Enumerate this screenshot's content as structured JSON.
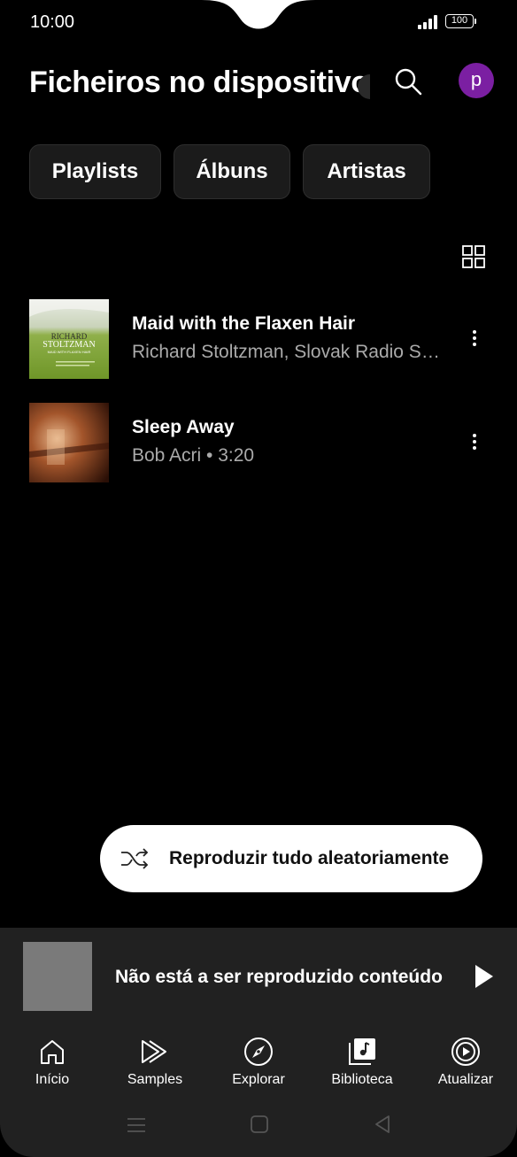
{
  "status": {
    "time": "10:00",
    "battery": "100"
  },
  "header": {
    "title": "Ficheiros no dispositivo",
    "avatar_letter": "p"
  },
  "chips": [
    "Playlists",
    "Álbuns",
    "Artistas"
  ],
  "songs": [
    {
      "title": "Maid with the Flaxen Hair",
      "subtitle": "Richard Stoltzman, Slovak Radio Symphony Orchestra",
      "art_text_1": "RICHARD",
      "art_text_2": "STOLTZMAN",
      "art_text_3": "MAID WITH FLAXEN HAIR"
    },
    {
      "title": "Sleep Away",
      "subtitle": "Bob Acri • 3:20"
    }
  ],
  "shuffle": {
    "label": "Reproduzir tudo aleatoriamente"
  },
  "mini_player": {
    "text": "Não está a ser reproduzido conteúdo"
  },
  "nav": [
    {
      "label": "Início",
      "icon": "home-icon"
    },
    {
      "label": "Samples",
      "icon": "samples-icon"
    },
    {
      "label": "Explorar",
      "icon": "compass-icon"
    },
    {
      "label": "Biblioteca",
      "icon": "library-icon"
    },
    {
      "label": "Atualizar",
      "icon": "upgrade-icon"
    }
  ],
  "colors": {
    "background": "#000000",
    "avatar": "#7b1fa2",
    "surface": "#212121",
    "chip": "#1b1b1b"
  }
}
